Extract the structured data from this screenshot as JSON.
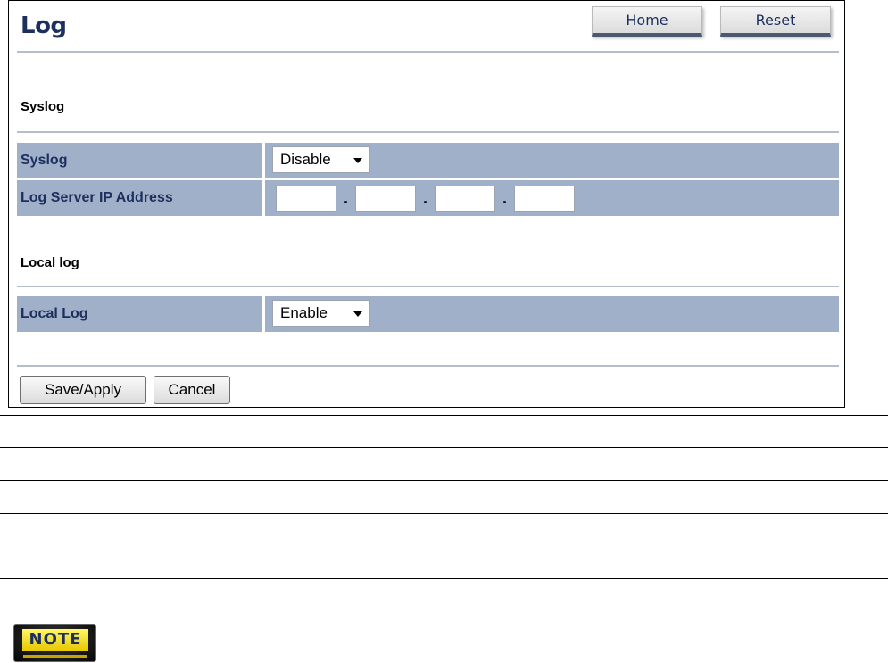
{
  "page": {
    "title": "Log",
    "home_label": "Home",
    "reset_label": "Reset"
  },
  "syslog_section": {
    "heading": "Syslog",
    "syslog_row": {
      "label": "Syslog",
      "value": "Disable"
    },
    "ip_row": {
      "label": "Log Server IP Address",
      "octets": [
        "",
        "",
        "",
        ""
      ]
    }
  },
  "local_section": {
    "heading": "Local log",
    "local_log_row": {
      "label": "Local Log",
      "value": "Enable"
    }
  },
  "actions": {
    "save_label": "Save/Apply",
    "cancel_label": "Cancel"
  },
  "note": {
    "badge_text": "NOTE"
  },
  "colors": {
    "accent": "#1c2f5e",
    "row_background": "#9fb0c8",
    "note_yellow": "#f5e01a"
  },
  "icons": [
    "select-arrow-icon",
    "note-icon"
  ]
}
